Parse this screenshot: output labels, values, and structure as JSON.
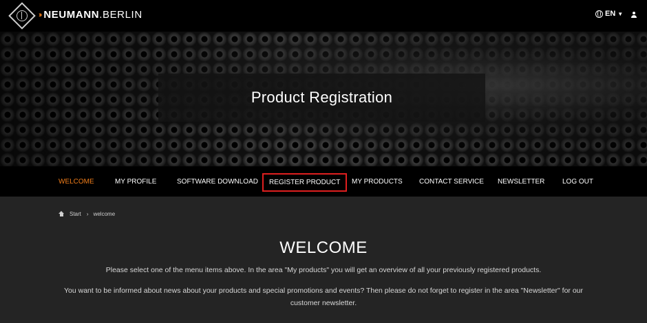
{
  "header": {
    "brand_name": "NEUMANN",
    "brand_suffix": ".BERLIN",
    "brand_arrows": "››",
    "language": "EN",
    "icons": {
      "globe": "globe-icon",
      "user": "user-icon",
      "caret": "chevron-down-icon",
      "logo": "neumann-logo"
    }
  },
  "hero": {
    "title": "Product Registration"
  },
  "nav": {
    "items": [
      {
        "label": "WELCOME",
        "active": true
      },
      {
        "label": "MY PROFILE"
      },
      {
        "label": "SOFTWARE DOWNLOAD"
      },
      {
        "label": "REGISTER PRODUCT",
        "highlighted": true
      },
      {
        "label": "MY PRODUCTS"
      },
      {
        "label": "CONTACT SERVICE"
      },
      {
        "label": "NEWSLETTER"
      },
      {
        "label": "LOG OUT"
      }
    ]
  },
  "breadcrumb": {
    "start": "Start",
    "separator": "›",
    "current": "welcome"
  },
  "content": {
    "title": "WELCOME",
    "para1": "Please select one of the menu items above. In the area \"My products\" you will get an overview of all your previously registered products.",
    "para2": "You want to be informed about news about your products and special promotions and events? Then please do not forget to register in the area \"Newsletter\" for our customer newsletter."
  },
  "colors": {
    "accent": "#f07d1a",
    "highlight_border": "#e01f1f",
    "background": "#242424",
    "header": "#000000"
  }
}
